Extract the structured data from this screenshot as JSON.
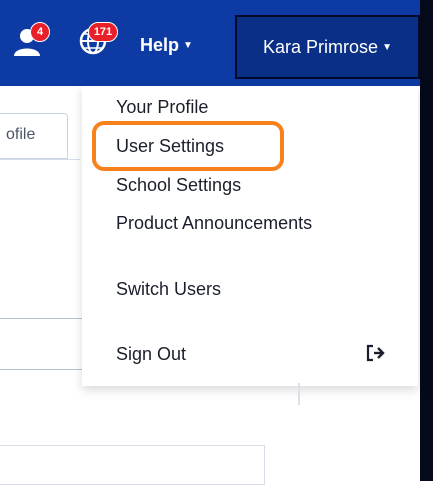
{
  "nav": {
    "notifications_count": "4",
    "global_count": "171",
    "help_label": "Help",
    "user_name": "Kara Primrose"
  },
  "background": {
    "tab_partial_label": "ofile"
  },
  "menu": {
    "items": [
      {
        "label": "Your Profile"
      },
      {
        "label": "User Settings"
      },
      {
        "label": "School Settings"
      },
      {
        "label": "Product Announcements"
      },
      {
        "label": "Switch Users"
      },
      {
        "label": "Sign Out"
      }
    ]
  },
  "colors": {
    "nav_bg": "#0d3aa3",
    "badge": "#e8202a",
    "highlight": "#f7821b"
  }
}
